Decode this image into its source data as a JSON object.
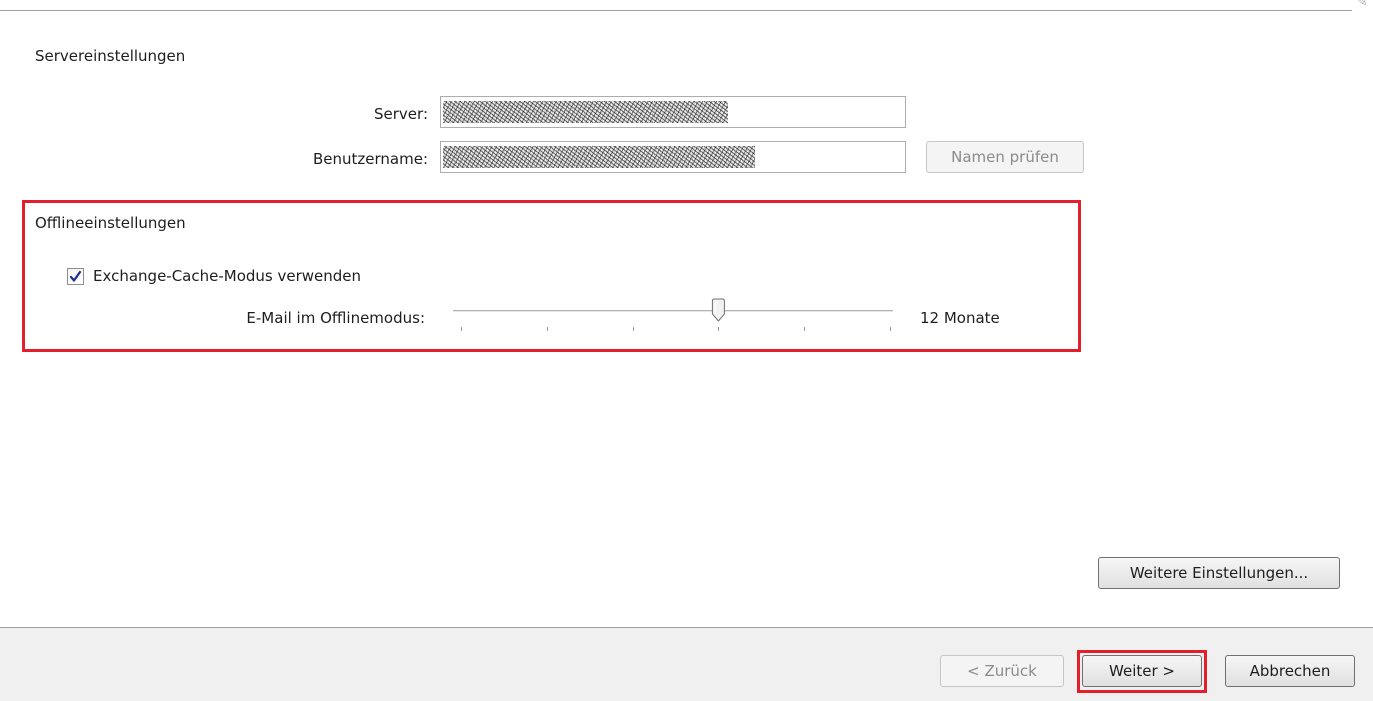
{
  "server_settings": {
    "title": "Servereinstellungen",
    "server_label": "Server:",
    "username_label": "Benutzername:",
    "check_names_button": "Namen prüfen"
  },
  "offline_settings": {
    "title": "Offlineeinstellungen",
    "cache_mode_label": "Exchange-Cache-Modus verwenden",
    "cache_mode_checked": true,
    "offline_mail_label": "E-Mail im Offlinemodus:",
    "offline_mail_value": "12 Monate",
    "slider_position_fraction": 0.6
  },
  "more_settings_button": "Weitere Einstellungen...",
  "footer": {
    "back_button": "< Zurück",
    "next_button": "Weiter >",
    "cancel_button": "Abbrechen"
  },
  "colors": {
    "highlight": "#e2202c",
    "checkmark": "#1c2e8c"
  }
}
